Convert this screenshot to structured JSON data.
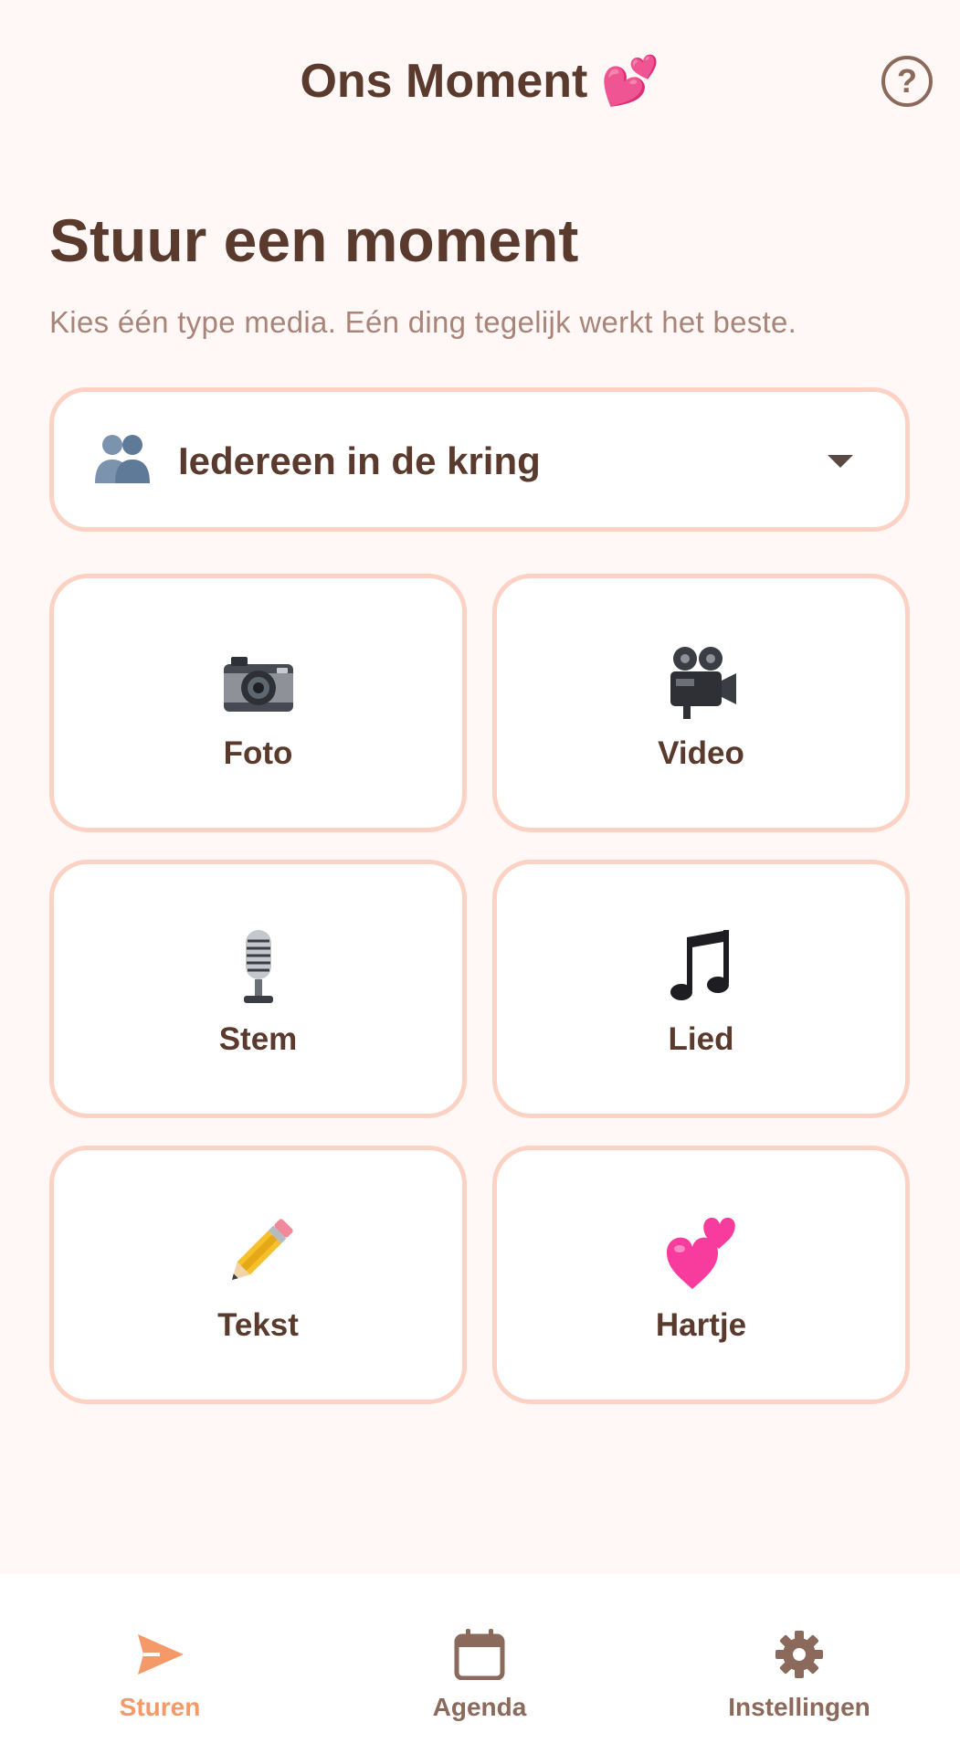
{
  "header": {
    "title": "Ons Moment 💕",
    "help_icon": "help-circle-icon"
  },
  "main": {
    "title": "Stuur een moment",
    "subtitle": "Kies één type media. Eén ding tegelijk werkt het beste.",
    "recipient": {
      "icon": "people-icon",
      "value": "Iedereen in de kring"
    },
    "media_types": [
      {
        "label": "Foto",
        "icon": "camera-icon"
      },
      {
        "label": "Video",
        "icon": "video-camera-icon"
      },
      {
        "label": "Stem",
        "icon": "microphone-icon"
      },
      {
        "label": "Lied",
        "icon": "music-note-icon"
      },
      {
        "label": "Tekst",
        "icon": "pencil-icon"
      },
      {
        "label": "Hartje",
        "icon": "hearts-icon"
      }
    ]
  },
  "bottom_nav": {
    "items": [
      {
        "label": "Sturen",
        "icon": "send-icon",
        "active": true
      },
      {
        "label": "Agenda",
        "icon": "calendar-icon",
        "active": false
      },
      {
        "label": "Instellingen",
        "icon": "gear-icon",
        "active": false
      }
    ]
  },
  "colors": {
    "background": "#fff8f6",
    "text": "#5b3a2e",
    "muted": "#a98478",
    "border": "#fbd2c4",
    "accent": "#f49a68"
  }
}
